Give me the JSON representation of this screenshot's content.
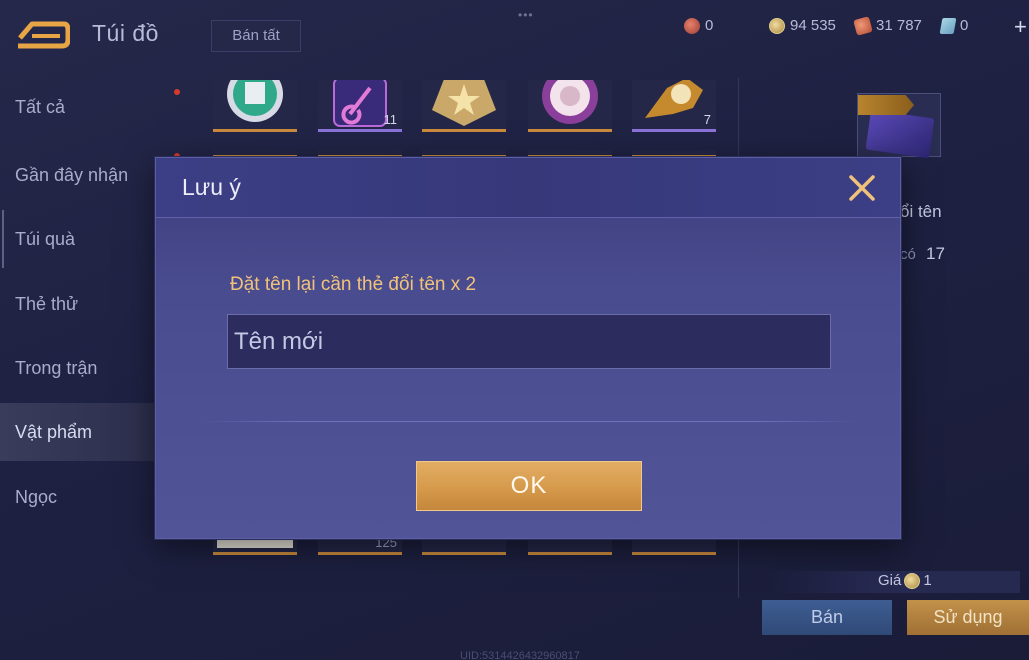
{
  "header": {
    "title": "Túi đồ",
    "sell_all_label": "Bán tất",
    "drag_handle": "•••",
    "currencies": [
      {
        "icon": "red-gem-icon",
        "value": "0"
      },
      {
        "icon": "gold-coin-icon",
        "value": "94 535"
      },
      {
        "icon": "voucher-icon",
        "value": "31 787"
      },
      {
        "icon": "card-icon",
        "value": "0"
      }
    ],
    "plus_label": "+"
  },
  "sidebar": {
    "items": [
      {
        "label": "Tất cả"
      },
      {
        "label": "Gần đây nhận"
      },
      {
        "label": "Túi quà"
      },
      {
        "label": "Thẻ thử"
      },
      {
        "label": "Trong trận"
      },
      {
        "label": "Vật phẩm"
      },
      {
        "label": "Ngọc"
      }
    ],
    "active_index": 5
  },
  "grid": {
    "top_row_counts": [
      "",
      "11",
      "",
      "",
      "7"
    ],
    "bottom_row_counts": [
      "",
      "125",
      "",
      "",
      ""
    ]
  },
  "detail": {
    "name_partial": "ổi tên",
    "owned_label": "có",
    "owned_value": "17",
    "price_label": "Giá",
    "price_value": "1",
    "sell_label": "Bán",
    "use_label": "Sử dụng"
  },
  "uid": "UID:5314426432960817",
  "modal": {
    "title": "Lưu ý",
    "message": "Đặt tên lại cần thẻ đổi tên x 2",
    "input_placeholder": "Tên mới",
    "input_value": "",
    "ok_label": "OK"
  },
  "colors": {
    "accent_gold": "#f0c27a",
    "ok_button": "#d69a4c",
    "modal_bg": "#4a4c90"
  }
}
